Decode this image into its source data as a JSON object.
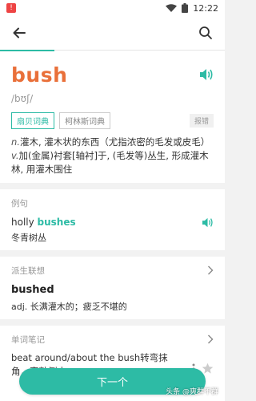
{
  "status_bar": {
    "time": "12:22",
    "battery_icon": "battery-icon",
    "wifi_icon": "wifi-icon"
  },
  "header": {
    "back_icon": "back-arrow-icon",
    "search_icon": "search-icon"
  },
  "word": {
    "headword": "bush",
    "phonetic": "/bʊʃ/",
    "speaker_icon": "speaker-icon",
    "dict_tabs": [
      "扇贝词典",
      "柯林斯词典"
    ],
    "active_tab": "扇贝词典",
    "report_label": "报错",
    "definitions": [
      {
        "pos": "n.",
        "text": "灌木, 灌木状的东西（尤指浓密的毛发或皮毛）"
      },
      {
        "pos": "v.",
        "text": "加(金属)衬套[轴衬]于, (毛发等)丛生, 形成灌木林, 用灌木围住"
      }
    ]
  },
  "example": {
    "title": "例句",
    "en_prefix": "holly ",
    "en_highlight": "bushes",
    "cn": "冬青树丛"
  },
  "derived": {
    "title": "派生联想",
    "word": "bushed",
    "definition": "adj. 长满灌木的；疲乏不堪的"
  },
  "notes": {
    "title": "单词笔记",
    "text": "beat around/about the bush转弯抹角，旁敲侧击"
  },
  "next_button": "下一个",
  "watermark": "头条 @爽群不群",
  "colors": {
    "accent": "#2dbba5",
    "headword": "#e9703a"
  }
}
